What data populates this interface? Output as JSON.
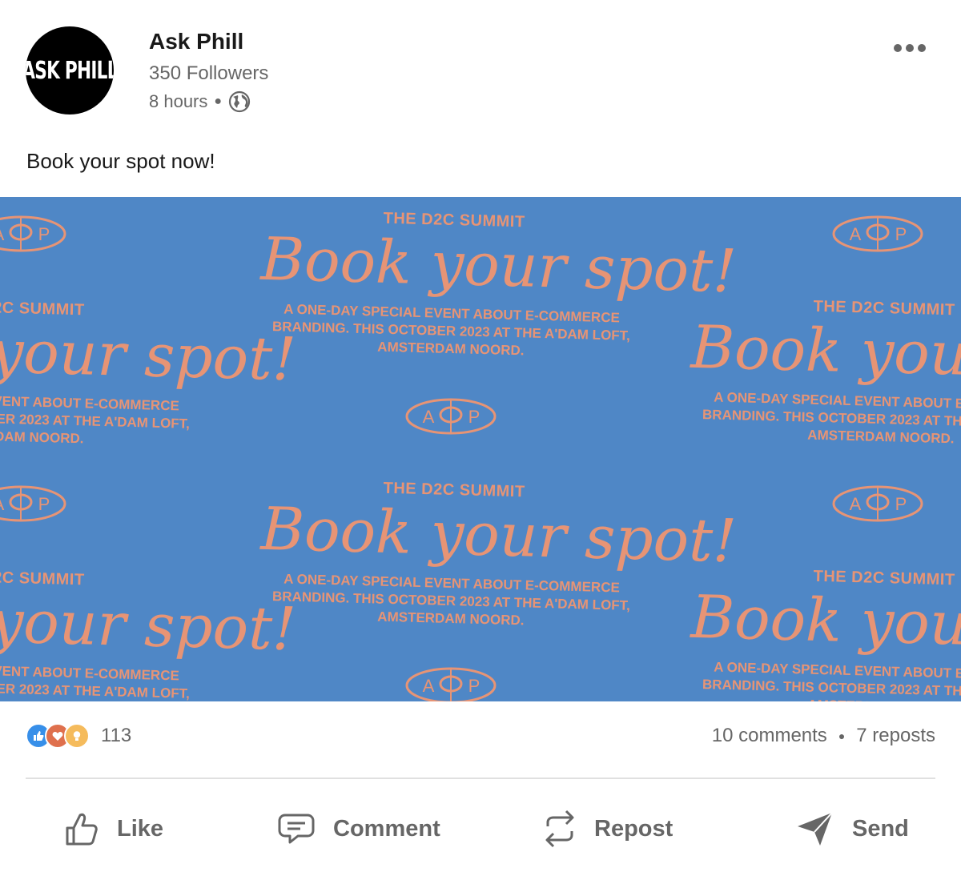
{
  "post": {
    "author": "Ask Phill",
    "avatar_text": "ASK PHILL",
    "followers": "350 Followers",
    "time": "8 hours",
    "visibility_icon": "globe-icon",
    "more_icon": "more-horizontal-icon",
    "text": "Book your spot now!"
  },
  "banner": {
    "event_label": "THE D2C SUMMIT",
    "headline": "Book your spot!",
    "description_lines": [
      "A ONE-DAY SPECIAL EVENT ABOUT E-COMMERCE",
      "BRANDING. THIS OCTOBER 2023 AT THE A'DAM LOFT,",
      "AMSTERDAM NOORD."
    ],
    "logo_left": "A",
    "logo_right": "P",
    "background_color": "#4f87c6",
    "text_color": "#e79475"
  },
  "stats": {
    "reaction_icons": [
      "like-icon",
      "love-icon",
      "insightful-icon"
    ],
    "reaction_count": "113",
    "comments": "10 comments",
    "reposts": "7 reposts"
  },
  "actions": {
    "like": "Like",
    "comment": "Comment",
    "repost": "Repost",
    "send": "Send"
  }
}
